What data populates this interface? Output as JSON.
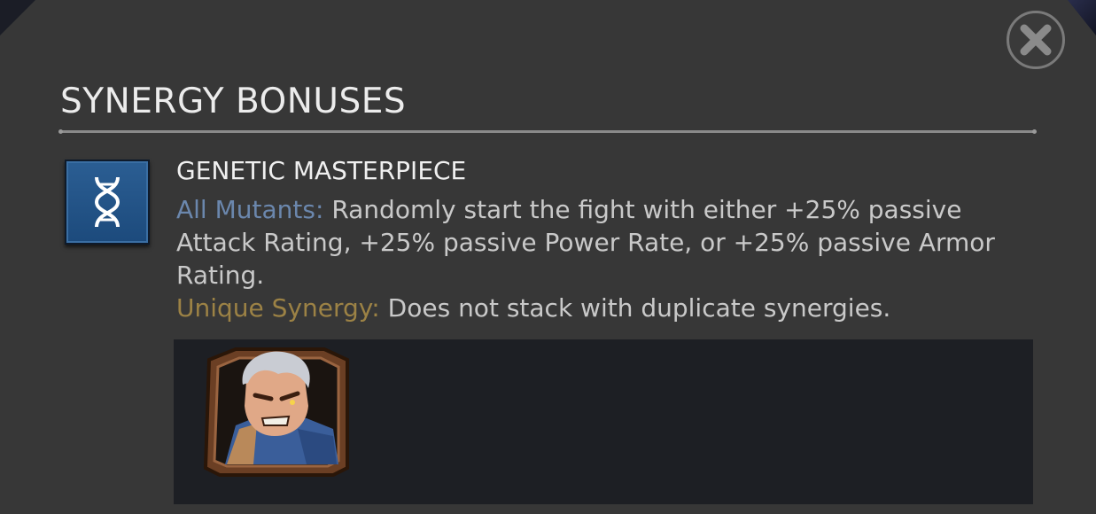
{
  "window": {
    "title": "SYNERGY BONUSES"
  },
  "close_button": {
    "icon": "close-icon"
  },
  "synergy": {
    "icon": "dna-icon",
    "name": "GENETIC MASTERPIECE",
    "mutants_label": "All Mutants:",
    "mutants_text": "Randomly start the fight with either +25% passive Attack Rating, +25% passive Power Rate, or +25% passive Armor Rating.",
    "unique_label": "Unique Synergy:",
    "unique_text": "Does not stack with duplicate synergies."
  },
  "champions": [
    {
      "icon": "champion-portrait"
    }
  ],
  "colors": {
    "panel": "#373737",
    "mutants_label": "#6b87ad",
    "unique_label": "#9c8245",
    "icon_blue": "#2b5e93"
  }
}
